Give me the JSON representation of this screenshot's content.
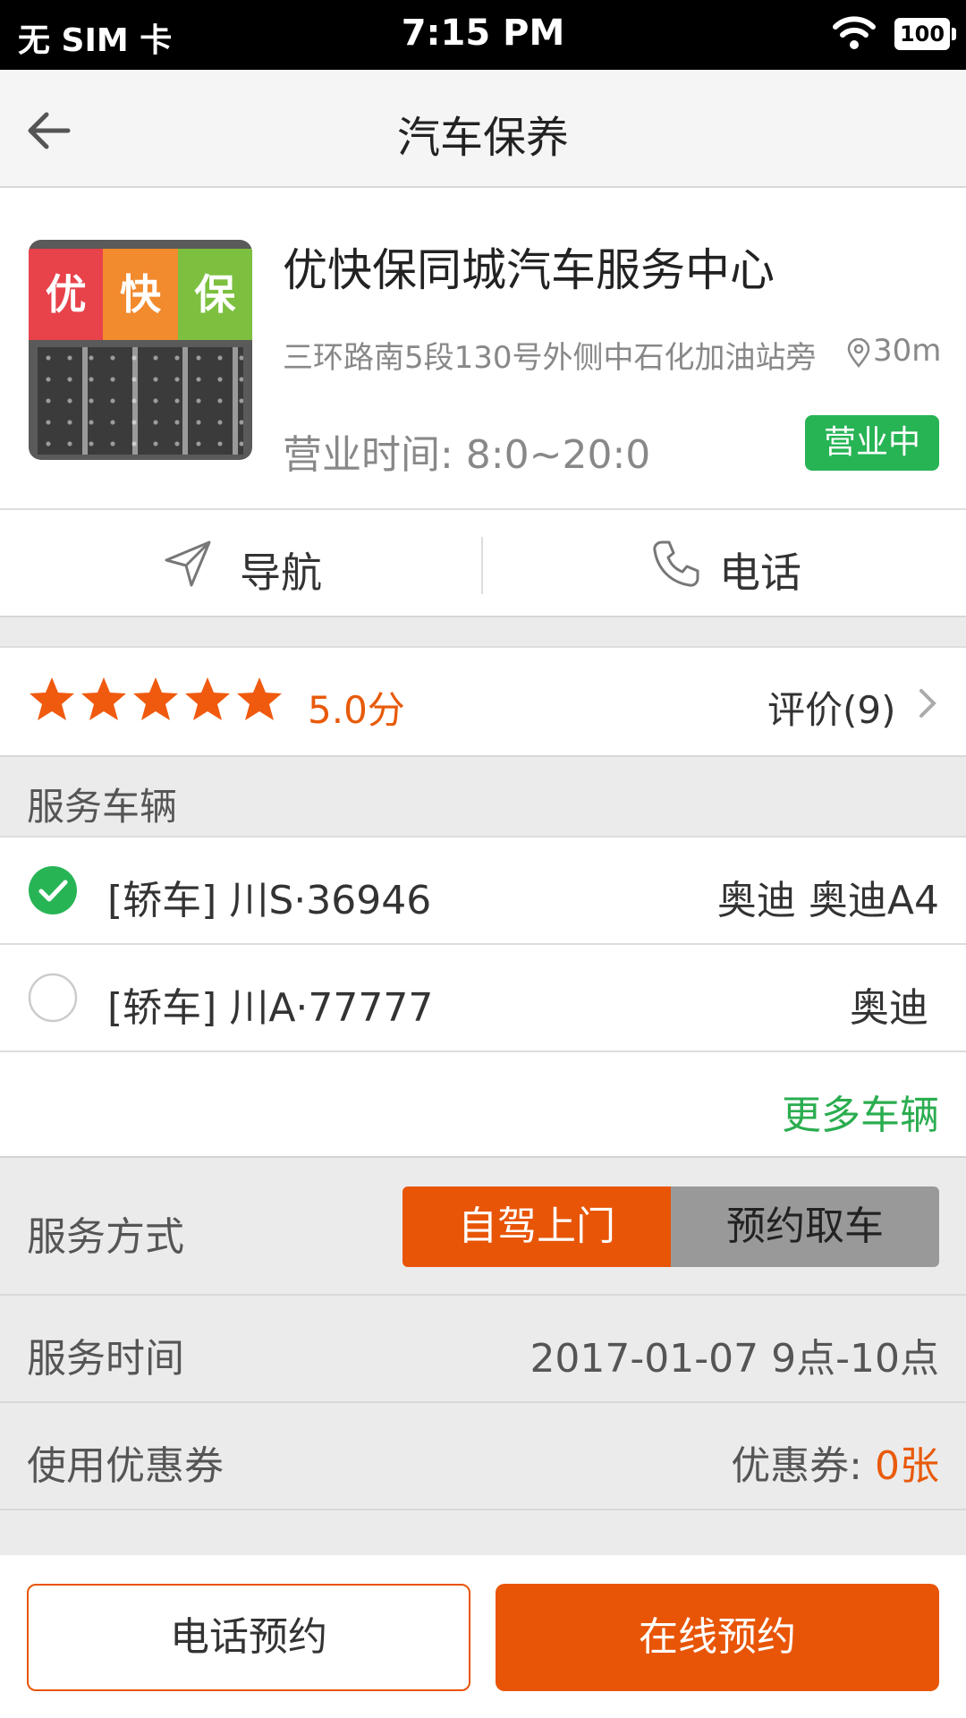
{
  "status_bar": {
    "carrier": "无 SIM 卡",
    "time": "7:15 PM",
    "battery": "100"
  },
  "header": {
    "title": "汽车保养"
  },
  "shop": {
    "name": "优快保同城汽车服务中心",
    "logo_text": [
      "优",
      "快",
      "保"
    ],
    "address": "三环路南5段130号外侧中石化加油站旁",
    "distance": "30m",
    "hours": "营业时间: 8:0~20:0",
    "status": "营业中"
  },
  "actions": {
    "navigate": "导航",
    "phone": "电话"
  },
  "rating": {
    "stars": 5,
    "score": "5.0分",
    "reviews": "评价(9)"
  },
  "vehicles": {
    "section_title": "服务车辆",
    "items": [
      {
        "plate": "[轿车] 川S·36946",
        "model": "奥迪 奥迪A4",
        "selected": true
      },
      {
        "plate": "[轿车] 川A·77777",
        "model": "奥迪",
        "selected": false
      }
    ],
    "more": "更多车辆"
  },
  "service": {
    "method_label": "服务方式",
    "options": [
      "自驾上门",
      "预约取车"
    ],
    "selected": "自驾上门",
    "time_label": "服务时间",
    "time_value": "2017-01-07 9点-10点",
    "coupon_label": "使用优惠券",
    "coupon_prefix": "优惠券: ",
    "coupon_count": "0张"
  },
  "bottom": {
    "phone_book": "电话预约",
    "online_book": "在线预约"
  },
  "colors": {
    "accent": "#e85507",
    "green": "#27b455",
    "star": "#f05a0f"
  }
}
